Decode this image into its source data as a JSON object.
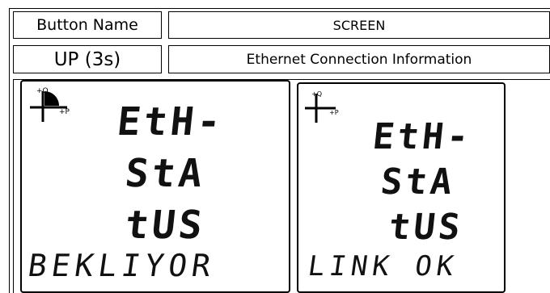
{
  "table": {
    "header": {
      "button_col": "Button Name",
      "screen_col": "SCREEN"
    },
    "row": {
      "button": "UP (3s)",
      "screen": "Ethernet Connection Information"
    }
  },
  "screens": [
    {
      "lines": [
        "EtH-",
        "StA",
        "tUS"
      ],
      "status": "BEKLIYOR",
      "quadrant_icon": "quadrant-crosshair-filled-icon"
    },
    {
      "lines": [
        "EtH-",
        "StA",
        "tUS"
      ],
      "status": "LINK OK",
      "quadrant_icon": "quadrant-crosshair-icon"
    }
  ]
}
